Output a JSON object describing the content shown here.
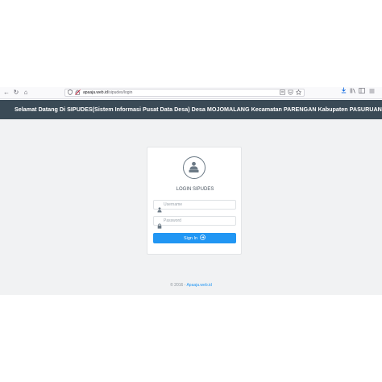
{
  "browser": {
    "back": "←",
    "reload": "↻",
    "home": "⌂",
    "url_host": "apaaja.web.id",
    "url_path": "/sipudes/login"
  },
  "header": {
    "title": "Selamat Datang Di SIPUDES(Sistem Informasi Pusat Data Desa) Desa MOJOMALANG Kecamatan PARENGAN Kabupaten PASURUAN"
  },
  "login": {
    "title": "LOGIN SIPUDES",
    "username_placeholder": "Username",
    "password_placeholder": "Password",
    "signin_label": "Sign In"
  },
  "footer": {
    "copyright": "© 2016 - ",
    "link_text": "Apaaja.web.id"
  },
  "colors": {
    "header_bg": "#3a4a56",
    "accent": "#2196f3",
    "content_bg": "#f1f2f3"
  }
}
